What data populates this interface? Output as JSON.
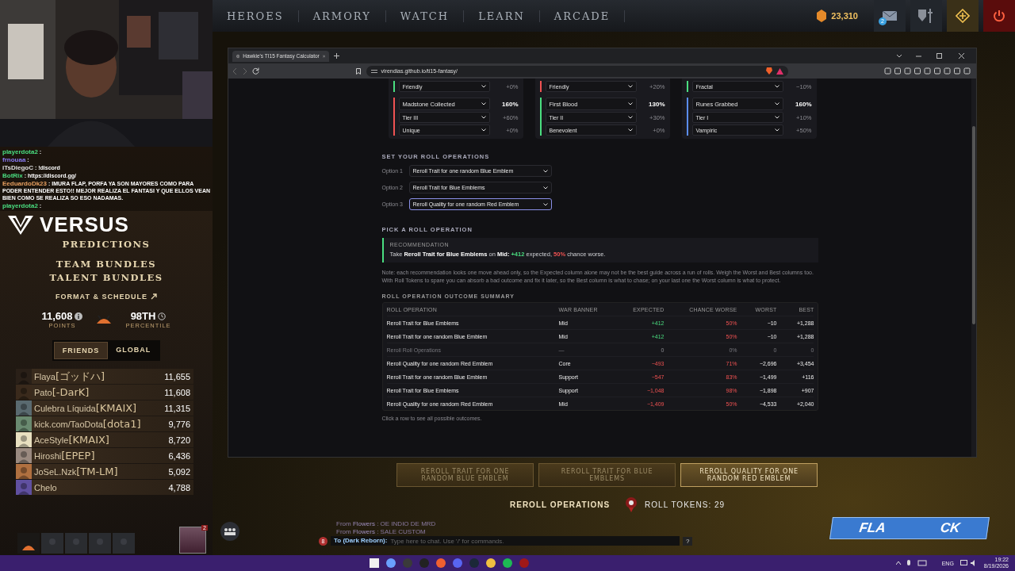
{
  "stream_chat": [
    {
      "user": "playerdota2",
      "color": "#4ade80",
      "message": ":"
    },
    {
      "user": "frnouaa",
      "color": "#8b7cf6",
      "message": ":"
    },
    {
      "user": "iTsDiegoC",
      "color": "#e0e0e0",
      "message": ": !discord"
    },
    {
      "user": "BotRix",
      "color": "#4ade80",
      "message": ": https://discord.gg/"
    },
    {
      "user": "EeduardoDk23",
      "color": "#e8a060",
      "message": ": IMURA FLAP, PORFA YA SON MAYORES COMO PARA PODER ENTENDER ESTO!! MEJOR REALIZA EL FANTASI Y QUE ELLOS VEAN BIEN COMO SE REALIZA SO ESO NADAMAS."
    },
    {
      "user": "playerdota2",
      "color": "#4ade80",
      "message": ":"
    }
  ],
  "overlay_logo": "VERSUS",
  "sidebar": {
    "links": [
      "PREDICTIONS",
      "TEAM BUNDLES",
      "TALENT BUNDLES"
    ],
    "schedule_link": "FORMAT & SCHEDULE",
    "points": {
      "value": "11,608",
      "label": "POINTS"
    },
    "percentile": {
      "value": "98TH",
      "label": "PERCENTILE"
    },
    "tabs": [
      {
        "label": "FRIENDS",
        "selected": true
      },
      {
        "label": "GLOBAL",
        "selected": false
      }
    ],
    "leaderboard": [
      {
        "name": "Flaya",
        "tag": "[ゴッドハ]",
        "score": "11,655"
      },
      {
        "name": "Pato",
        "tag": "[-DarK]",
        "score": "11,608"
      },
      {
        "name": "Culebra Líquida",
        "tag": "[KMAIX]",
        "score": "11,315"
      },
      {
        "name": "kick.com/TaoDota",
        "tag": "[dota1]",
        "score": "9,776"
      },
      {
        "name": "AceStyle",
        "tag": "[KMAIX]",
        "score": "8,720"
      },
      {
        "name": "Hiroshi",
        "tag": "[EPEP]",
        "score": "6,436"
      },
      {
        "name": "JoSeL.Nzk",
        "tag": "[TM-LM]",
        "score": "5,092"
      },
      {
        "name": "Chelo",
        "score": "4,788"
      }
    ],
    "notification_count": "2"
  },
  "game_nav": [
    "HEROES",
    "ARMORY",
    "WATCH",
    "LEARN",
    "ARCADE"
  ],
  "currency": "23,310",
  "mail_count": "2",
  "browser": {
    "tab_title": "Hawkie's TI15 Fantasy Calculator",
    "url": "virendias.github.io/ti15-fantasy/"
  },
  "card_columns": [
    {
      "segments": [
        {
          "color": "#4ade80",
          "rows": [
            {
              "value": "Friendly",
              "mod": "+0%"
            }
          ]
        },
        {
          "color": "#f05252",
          "stat": {
            "value": "Madstone Collected",
            "total": "160%"
          },
          "rows": [
            {
              "value": "Tier III",
              "mod": "+60%"
            },
            {
              "value": "Unique",
              "mod": "+0%"
            }
          ]
        }
      ]
    },
    {
      "segments": [
        {
          "color": "#f05252",
          "rows": [
            {
              "value": "Friendly",
              "mod": "+20%"
            }
          ]
        },
        {
          "color": "#4ade80",
          "stat": {
            "value": "First Blood",
            "total": "130%"
          },
          "rows": [
            {
              "value": "Tier II",
              "mod": "+30%"
            },
            {
              "value": "Benevolent",
              "mod": "+0%"
            }
          ]
        }
      ]
    },
    {
      "segments": [
        {
          "color": "#4ade80",
          "rows": [
            {
              "value": "Fractal",
              "mod": "−10%"
            }
          ]
        },
        {
          "color": "#5b8def",
          "stat": {
            "value": "Runes Grabbed",
            "total": "160%"
          },
          "rows": [
            {
              "value": "Tier I",
              "mod": "+10%"
            },
            {
              "value": "Vampiric",
              "mod": "+50%"
            }
          ]
        }
      ]
    }
  ],
  "roll_operations": {
    "heading": "SET YOUR ROLL OPERATIONS",
    "options": [
      {
        "label": "Option 1",
        "value": "Reroll Trait for one random Blue Emblem",
        "selected": false
      },
      {
        "label": "Option 2",
        "value": "Reroll Trait for Blue Emblems",
        "selected": false
      },
      {
        "label": "Option 3",
        "value": "Reroll Quality for one random Red Emblem",
        "selected": true
      }
    ]
  },
  "pick": {
    "heading": "PICK A ROLL OPERATION",
    "label": "RECOMMENDATION",
    "parts": [
      {
        "kind": "plain",
        "text": "Take "
      },
      {
        "kind": "bold",
        "text": "Reroll Trait for Blue Emblems"
      },
      {
        "kind": "plain",
        "text": " on "
      },
      {
        "kind": "bold",
        "text": "Mid:"
      },
      {
        "kind": "good",
        "text": " +412"
      },
      {
        "kind": "plain",
        "text": " expected, "
      },
      {
        "kind": "bad",
        "text": "50%"
      },
      {
        "kind": "plain",
        "text": " chance worse."
      }
    ],
    "note": "Note: each recommendation looks one move ahead only, so the Expected column alone may not be the best guide across a run of rolls. Weigh the Worst and Best columns too. With Roll Tokens to spare you can absorb a bad outcome and fix it later, so the Best column is what to chase; on your last one the Worst column is what to protect."
  },
  "summary": {
    "heading": "ROLL OPERATION OUTCOME SUMMARY",
    "columns": [
      "ROLL OPERATION",
      "WAR BANNER",
      "EXPECTED",
      "CHANCE WORSE",
      "WORST",
      "BEST"
    ],
    "rows": [
      {
        "operation": "Reroll Trait for Blue Emblems",
        "banner": "Mid",
        "expected": "+412",
        "kind": "gain",
        "chance": "50%",
        "worst": "−10",
        "best": "+1,288",
        "disabled": false
      },
      {
        "operation": "Reroll Trait for one random Blue Emblem",
        "banner": "Mid",
        "expected": "+412",
        "kind": "gain",
        "chance": "50%",
        "worst": "−10",
        "best": "+1,288",
        "disabled": false
      },
      {
        "operation": "Reroll Roll Operations",
        "banner": "—",
        "expected": "0",
        "kind": "even",
        "chance": "0%",
        "worst": "0",
        "best": "0",
        "disabled": true
      },
      {
        "operation": "Reroll Quality for one random Red Emblem",
        "banner": "Core",
        "expected": "−493",
        "kind": "loss",
        "chance": "71%",
        "worst": "−2,696",
        "best": "+3,454",
        "disabled": false
      },
      {
        "operation": "Reroll Trait for one random Blue Emblem",
        "banner": "Support",
        "expected": "−547",
        "kind": "loss",
        "chance": "83%",
        "worst": "−1,499",
        "best": "+116",
        "disabled": false
      },
      {
        "operation": "Reroll Trait for Blue Emblems",
        "banner": "Support",
        "expected": "−1,048",
        "kind": "loss",
        "chance": "98%",
        "worst": "−1,898",
        "best": "+907",
        "disabled": false
      },
      {
        "operation": "Reroll Quality for one random Red Emblem",
        "banner": "Mid",
        "expected": "−1,409",
        "kind": "loss",
        "chance": "50%",
        "worst": "−4,533",
        "best": "+2,040",
        "disabled": false
      }
    ],
    "hint": "Click a row to see all possible outcomes."
  },
  "game_buttons": [
    {
      "label": "REROLL TRAIT FOR ONE RANDOM BLUE EMBLEM",
      "selected": false
    },
    {
      "label": "REROLL TRAIT FOR BLUE EMBLEMS",
      "selected": false
    },
    {
      "label": "REROLL QUALITY FOR ONE RANDOM RED EMBLEM",
      "selected": true
    }
  ],
  "reroll_label": "REROLL OPERATIONS",
  "roll_tokens": "ROLL TOKENS: 29",
  "game_chat": {
    "lines": [
      {
        "prefix": "From",
        "user": "Flowers",
        "message": ": OE INDIO DE MRD"
      },
      {
        "prefix": "From",
        "user": "Flowers",
        "message": ": SALE CUSTOM"
      }
    ],
    "unread": "8",
    "target": "To (Dark Reborn):",
    "placeholder": "Type here to chat. Use '/' for commands.",
    "help": "?"
  },
  "overlay_name": [
    "FLA",
    "CK"
  ],
  "taskbar": {
    "language": "ENG",
    "time": "19:22",
    "date": "8/19/2026"
  }
}
